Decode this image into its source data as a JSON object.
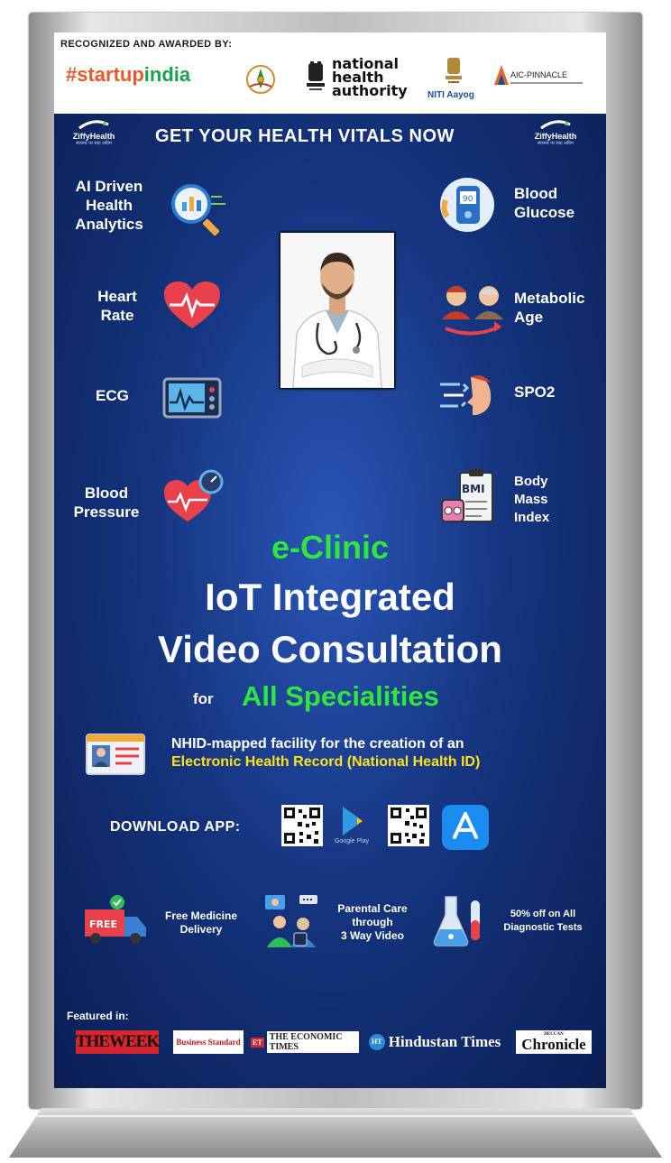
{
  "banner": {
    "recognized_label": "RECOGNIZED AND AWARDED BY:",
    "partners": {
      "startup_prefix": "#startup",
      "startup_suffix": "india",
      "nha_line1": "national",
      "nha_line2": "health",
      "nha_line3": "authority",
      "niti": "NITI Aayog",
      "aic": "AIC-PINNACLE"
    },
    "brand_name": "ZiffyHealth",
    "brand_tagline": "स्वास्थ्य पर सदा अग्रिम",
    "headline": "GET YOUR HEALTH VITALS NOW",
    "left_features": {
      "ai": [
        "AI Driven",
        "Health",
        "Analytics"
      ],
      "heart": [
        "Heart",
        "Rate"
      ],
      "ecg": [
        "ECG"
      ],
      "bp": [
        "Blood",
        "Pressure"
      ]
    },
    "right_features": {
      "glucose": [
        "Blood",
        "Glucose"
      ],
      "metabolic": [
        "Metabolic",
        "Age"
      ],
      "spo2": [
        "SPO2"
      ],
      "bmi": [
        "Body",
        "Mass",
        "Index"
      ]
    },
    "bmi_icon_text": "BMI",
    "title_green": "e-Clinic",
    "title_line1": "IoT Integrated",
    "title_line2": "Video Consultation",
    "for_word": "for",
    "specialities": "All Specialities",
    "nhid_line1": "NHID-mapped facility for the creation of an",
    "nhid_line2": "Electronic Health Record (National Health ID)",
    "download_label": "DOWNLOAD APP:",
    "google_play_label": "Google Play",
    "benefits": {
      "free_badge": "FREE",
      "medicine": [
        "Free Medicine",
        "Delivery"
      ],
      "parental": [
        "Parental Care",
        "through",
        "3 Way Video"
      ],
      "diagnostic": [
        "50% off on All",
        "Diagnostic Tests"
      ]
    },
    "featured_label": "Featured in:",
    "publications": [
      "THEWEEK",
      "Business Standard",
      "THE ECONOMIC TIMES",
      "Hindustan Times",
      "Chronicle"
    ],
    "publication_marks": {
      "et": "ET",
      "ht": "HT",
      "deccan": "DECCAN"
    },
    "colors": {
      "accent_green": "#2ee63c",
      "highlight_yellow": "#ffe21a",
      "panel_blue": "#15357f"
    }
  }
}
